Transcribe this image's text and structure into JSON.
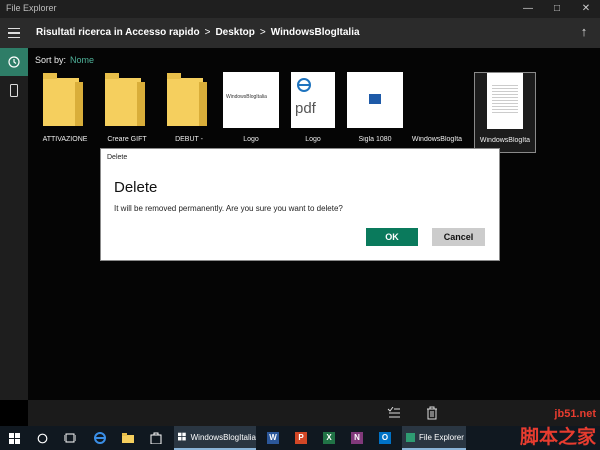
{
  "window": {
    "title": "File Explorer"
  },
  "path": {
    "crumbs": [
      "Risultati ricerca in Accesso rapido",
      "Desktop",
      "WindowsBlogItalia"
    ],
    "separator": ">"
  },
  "sort": {
    "label": "Sort by:",
    "value": "Nome"
  },
  "items": [
    {
      "label": "ATTIVAZIONE",
      "type": "folder"
    },
    {
      "label": "Creare GIFT",
      "type": "folder"
    },
    {
      "label": "DEBUT -",
      "type": "folder"
    },
    {
      "label": "Logo",
      "type": "image",
      "thumb_text": "WindowsBlogItalia"
    },
    {
      "label": "Logo",
      "type": "pdf",
      "thumb_text": "pdf"
    },
    {
      "label": "Sigla 1080",
      "type": "video"
    },
    {
      "label": "WindowsBlogIta",
      "type": "file"
    },
    {
      "label": "WindowsBlogIta",
      "type": "document",
      "selected": true
    }
  ],
  "dialog": {
    "title": "Delete",
    "heading": "Delete",
    "message": "It will be removed permanently. Are you sure you want to delete?",
    "ok_label": "OK",
    "cancel_label": "Cancel"
  },
  "taskbar": {
    "app1": "WindowsBlogItalia",
    "app2": "File Explorer"
  },
  "watermark": {
    "line1": "jb51.net",
    "line2": "脚本之家"
  },
  "colors": {
    "accent": "#0a7a5c",
    "sort_value": "#4fb39a",
    "folder": "#f5cf5e"
  }
}
